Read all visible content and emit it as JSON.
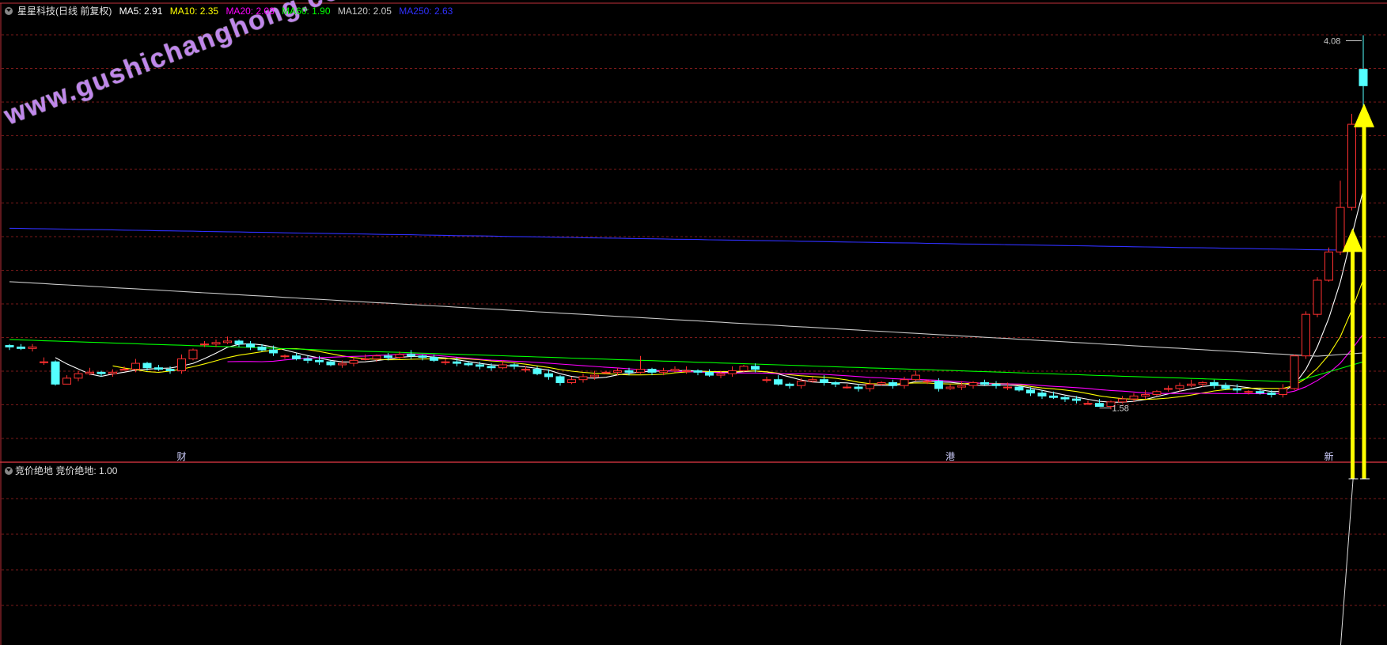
{
  "header": {
    "stock_name": "星星科技(日线 前复权)",
    "indicators": [
      {
        "label": "MA5: 2.91",
        "color": "#ffffff"
      },
      {
        "label": "MA10: 2.35",
        "color": "#ffff00"
      },
      {
        "label": "MA20: 2.03",
        "color": "#ff00ff"
      },
      {
        "label": "MA60: 1.90",
        "color": "#00ff00"
      },
      {
        "label": "MA120: 2.05",
        "color": "#c8c8c8"
      },
      {
        "label": "MA250: 2.63",
        "color": "#3030ff"
      }
    ]
  },
  "sub_panel": {
    "title": "竞价绝地",
    "value_label": "竞价绝地: 1.00"
  },
  "watermark": "www.gushichanghong.com",
  "colors": {
    "up": "#ff3030",
    "down": "#54ffff",
    "frame": "#c0303a",
    "grid": "#7a1a1a",
    "arrow": "#ffff00"
  },
  "chart_data": {
    "type": "candlestick",
    "y_axis": {
      "min": 1.3,
      "max": 4.2,
      "grid": true
    },
    "annotations": [
      {
        "text": "4.08",
        "type": "high",
        "bar": 118
      },
      {
        "text": "1.58",
        "type": "low",
        "bar": 95
      }
    ],
    "event_markers": [
      {
        "text": "财",
        "bar": 15
      },
      {
        "text": "港",
        "bar": 82
      },
      {
        "text": "新",
        "bar": 115
      }
    ],
    "candles": [],
    "ma_series": []
  }
}
